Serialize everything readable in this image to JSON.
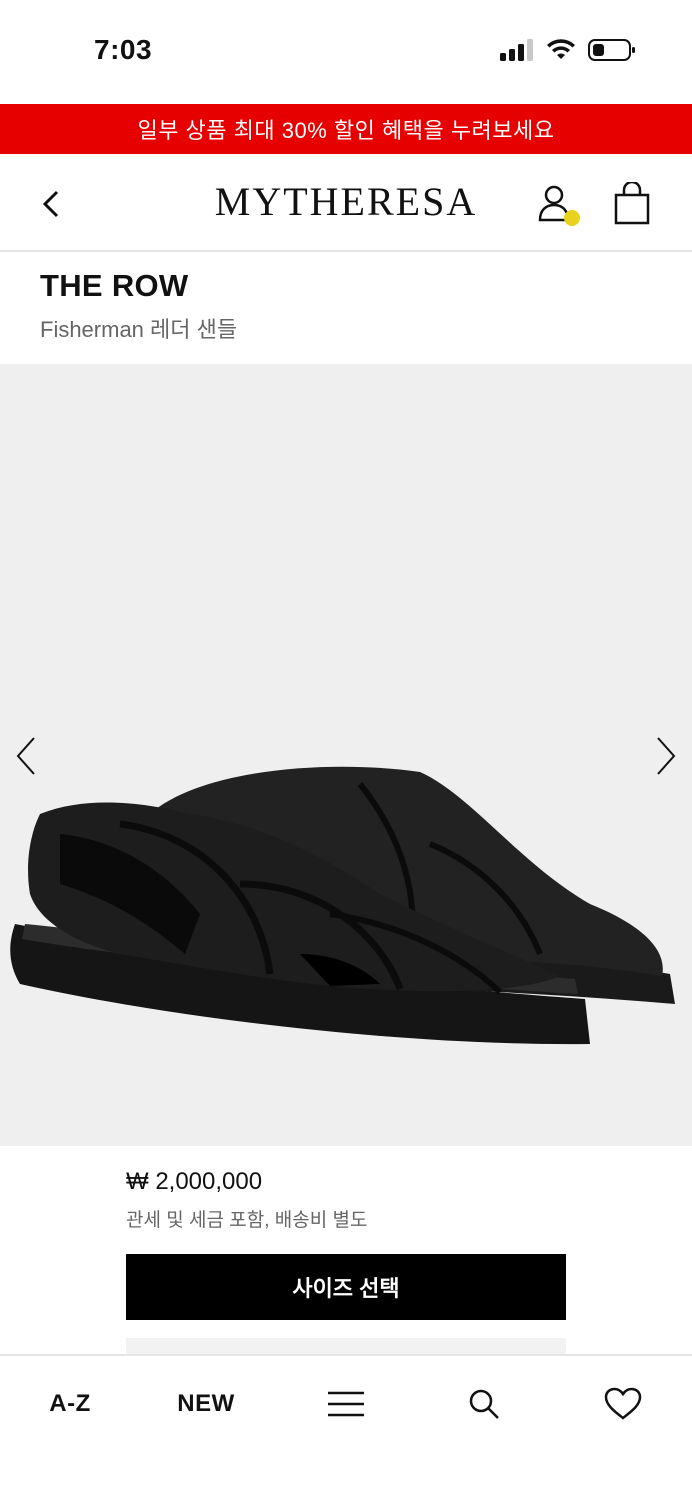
{
  "status_bar": {
    "time": "7:03"
  },
  "promo_banner": {
    "text": "일부 상품 최대 30% 할인 혜택을 누려보세요",
    "color": "#e60000"
  },
  "header": {
    "logo": "MYTHERESA",
    "back_icon": "chevron-left-icon",
    "account_icon": "user-icon",
    "account_dot_color": "#e8d21e",
    "bag_icon": "shopping-bag-icon"
  },
  "product": {
    "brand": "THE ROW",
    "name": "Fisherman 레더 샌들",
    "price": "₩ 2,000,000",
    "price_note": "관세 및 세금 포함, 배송비 별도",
    "select_size_label": "사이즈 선택"
  },
  "gallery": {
    "prev_icon": "chevron-left-icon",
    "next_icon": "chevron-right-icon",
    "background": "#efefef"
  },
  "bottom_nav": {
    "items": [
      {
        "label": "A-Z"
      },
      {
        "label": "NEW"
      },
      {
        "icon": "menu-icon"
      },
      {
        "icon": "search-icon"
      },
      {
        "icon": "heart-icon"
      }
    ]
  }
}
